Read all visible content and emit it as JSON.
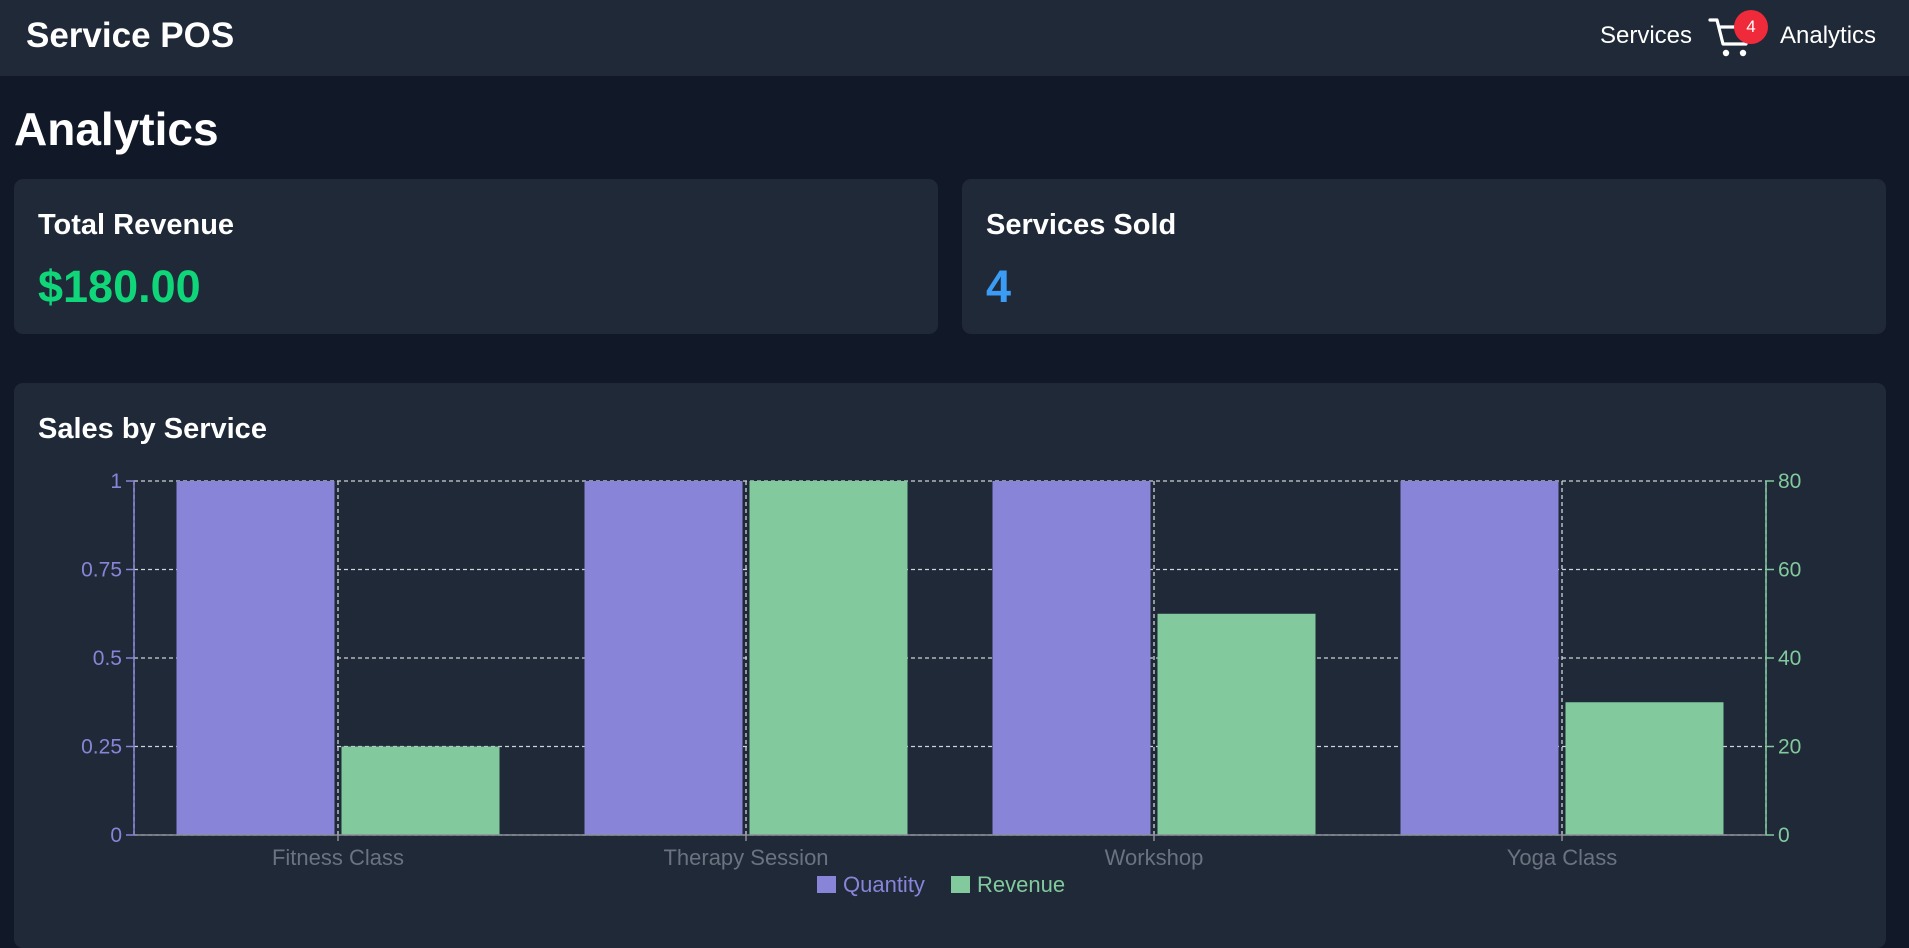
{
  "app": {
    "title": "Service POS"
  },
  "nav": {
    "services_label": "Services",
    "cart_icon": "cart-icon",
    "cart_count": "4",
    "analytics_label": "Analytics"
  },
  "page": {
    "title": "Analytics"
  },
  "stats": {
    "revenue_label": "Total Revenue",
    "revenue_value": "$180.00",
    "sold_label": "Services Sold",
    "sold_value": "4"
  },
  "colors": {
    "quantity": "#8884d8",
    "revenue": "#82ca9d",
    "revenue_value": "#10d67a",
    "sold_value": "#3b9cf6",
    "badge": "#ef2a3a"
  },
  "chart_data": {
    "type": "bar",
    "title": "Sales by Service",
    "categories": [
      "Fitness Class",
      "Therapy Session",
      "Workshop",
      "Yoga Class"
    ],
    "series": [
      {
        "name": "Quantity",
        "axis": "left",
        "values": [
          1,
          1,
          1,
          1
        ]
      },
      {
        "name": "Revenue",
        "axis": "right",
        "values": [
          20,
          80,
          50,
          30
        ]
      }
    ],
    "y_left": {
      "ticks": [
        "0",
        "0.25",
        "0.5",
        "0.75",
        "1"
      ],
      "ylim": [
        0,
        1
      ]
    },
    "y_right": {
      "ticks": [
        "0",
        "20",
        "40",
        "60",
        "80"
      ],
      "ylim": [
        0,
        80
      ]
    },
    "grid": true,
    "legend": "bottom-center"
  }
}
